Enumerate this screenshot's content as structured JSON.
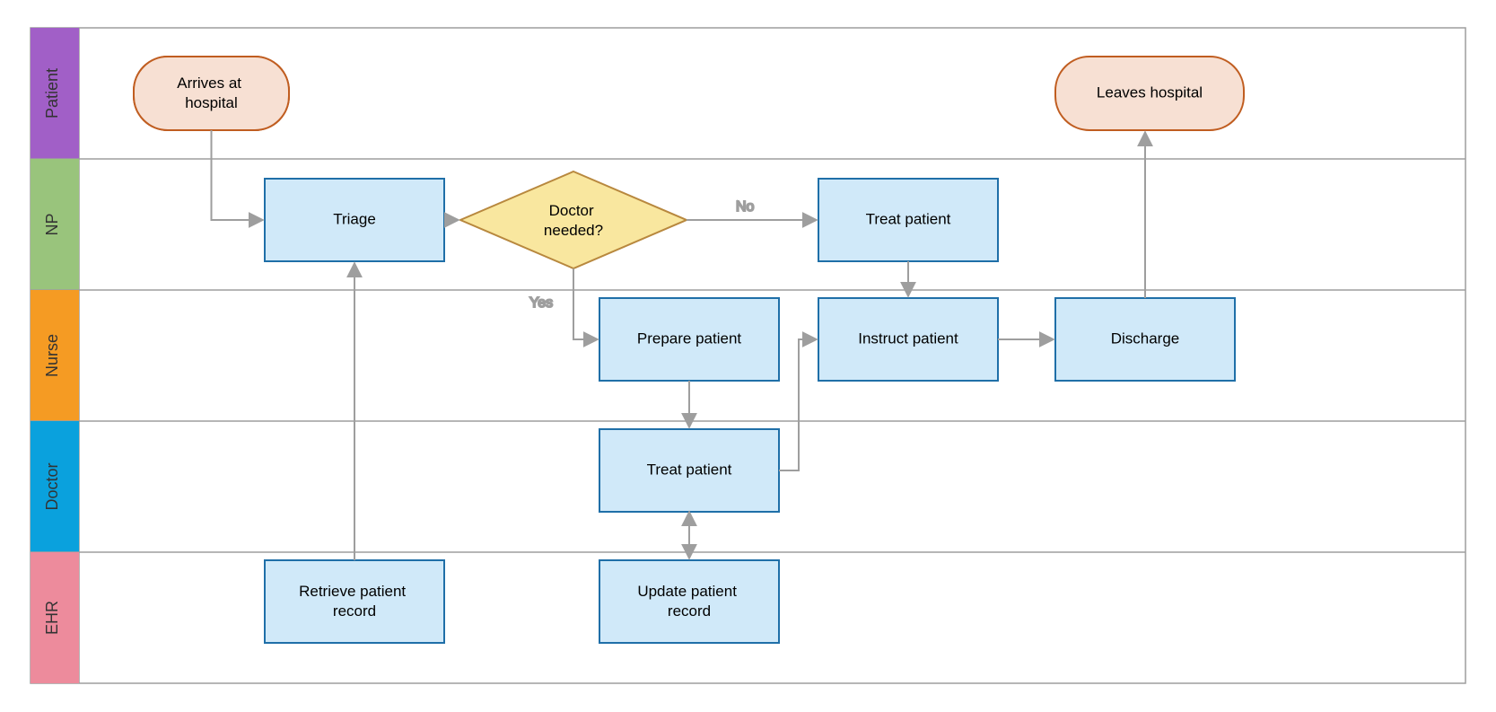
{
  "lanes": [
    {
      "id": "patient",
      "label": "Patient",
      "color": "#a15fc7"
    },
    {
      "id": "np",
      "label": "NP",
      "color": "#99c47c"
    },
    {
      "id": "nurse",
      "label": "Nurse",
      "color": "#f59b23"
    },
    {
      "id": "doctor",
      "label": "Doctor",
      "color": "#0aa1dd"
    },
    {
      "id": "ehr",
      "label": "EHR",
      "color": "#ed8b9c"
    }
  ],
  "nodes": {
    "arrives": {
      "label": "Arrives at hospital"
    },
    "triage": {
      "label": "Triage"
    },
    "doctor_needed": {
      "label": "Doctor needed?"
    },
    "treat_np": {
      "label": "Treat patient"
    },
    "prepare": {
      "label": "Prepare patient"
    },
    "instruct": {
      "label": "Instruct patient"
    },
    "discharge": {
      "label": "Discharge"
    },
    "treat_doc": {
      "label": "Treat patient"
    },
    "retrieve": {
      "label": "Retrieve patient record"
    },
    "update": {
      "label": "Update patient record"
    },
    "leaves": {
      "label": "Leaves hospital"
    }
  },
  "edge_labels": {
    "yes": "Yes",
    "no": "No"
  }
}
